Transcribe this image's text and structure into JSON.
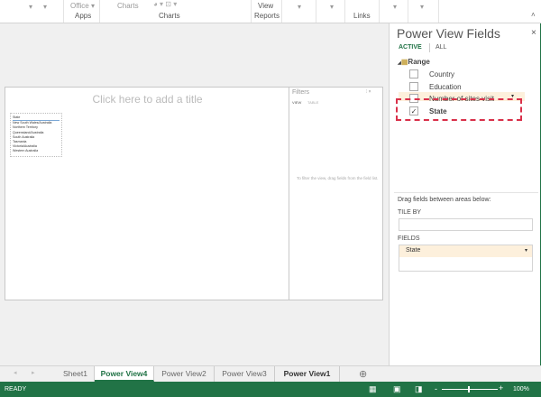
{
  "ribbon": {
    "office_label": "Office",
    "charts_top": "Charts",
    "view_top": "View",
    "groups": {
      "apps": "Apps",
      "charts": "Charts",
      "reports": "Reports",
      "links": "Links"
    }
  },
  "canvas": {
    "title_placeholder": "Click here to add a title",
    "table": {
      "header": "State",
      "rows": [
        "New South Wales/Australia",
        "Northern Territory",
        "Queensland/Australia",
        "South Australia",
        "Tasmania",
        "Victoria/Australia",
        "Western Australia"
      ]
    },
    "filters": {
      "title": "Filters",
      "tabs": [
        "VIEW",
        "TABLE"
      ],
      "hint": "To filter the view, drag fields from the field list."
    }
  },
  "pane": {
    "title": "Power View Fields",
    "tabs": {
      "active": "ACTIVE",
      "all": "ALL"
    },
    "table_name": "Range",
    "fields": [
      {
        "label": "Country",
        "checked": false
      },
      {
        "label": "Education",
        "checked": false
      },
      {
        "label": "Number of sites visit",
        "checked": false
      },
      {
        "label": "State",
        "checked": true
      }
    ],
    "drag_hint": "Drag fields between areas below:",
    "tile_by_label": "TILE BY",
    "fields_label": "FIELDS",
    "fields_value": "State"
  },
  "sheet_tabs": [
    {
      "label": "Sheet1"
    },
    {
      "label": "Power View4",
      "active": true
    },
    {
      "label": "Power View2"
    },
    {
      "label": "Power View3"
    },
    {
      "label": "Power View1",
      "bold": true
    }
  ],
  "status": {
    "ready": "READY",
    "zoom": "100%"
  },
  "colors": {
    "excel_green": "#217346",
    "highlight": "#fdf0dc",
    "selection": "#d9304a"
  }
}
